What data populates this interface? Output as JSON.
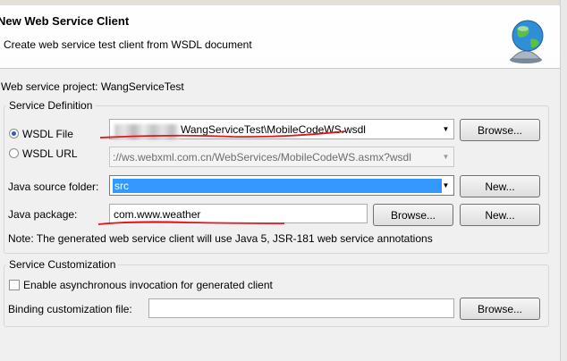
{
  "banner": {
    "title": "New Web Service Client",
    "description": "Create web service test client from WSDL document"
  },
  "project": {
    "label": "Web service project:",
    "value": "WangServiceTest"
  },
  "service_definition": {
    "title": "Service Definition",
    "wsdl_file_label": "WSDL File",
    "wsdl_file_value": "WangServiceTest\\MobileCodeWS.wsdl",
    "wsdl_url_label": "WSDL URL",
    "wsdl_url_value": "://ws.webxml.com.cn/WebServices/MobileCodeWS.asmx?wsdl",
    "browse_label": "Browse...",
    "selected_option": "WSDL File"
  },
  "java": {
    "source_folder_label": "Java source folder:",
    "source_folder_value": "src",
    "package_label": "Java package:",
    "package_value": "com.www.weather",
    "browse_label": "Browse...",
    "new_label": "New...",
    "note": "Note: The generated web service client will use Java 5, JSR-181 web service annotations"
  },
  "customization": {
    "title": "Service Customization",
    "async_label": "Enable asynchronous invocation for generated client",
    "async_checked": false,
    "binding_label": "Binding customization file:",
    "binding_value": "",
    "browse_label": "Browse..."
  },
  "icons": {
    "banner_icon": "globe-bell-icon",
    "dropdown": "chevron-down-icon"
  },
  "colors": {
    "selection": "#3399ff",
    "annotation": "#e0161c"
  }
}
